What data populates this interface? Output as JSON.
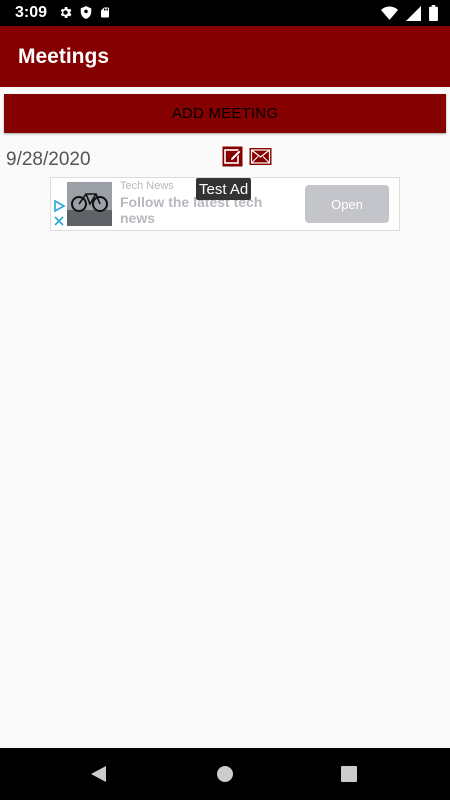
{
  "status_bar": {
    "time": "3:09",
    "left_icons": [
      "gear-icon",
      "shield-icon",
      "sd-card-icon"
    ],
    "right_icons": [
      "wifi-icon",
      "signal-icon",
      "battery-icon"
    ]
  },
  "app_bar": {
    "title": "Meetings"
  },
  "actions": {
    "add_meeting_label": "ADD MEETING"
  },
  "meetings": [
    {
      "date": "9/28/2020",
      "icons": [
        "edit-icon",
        "mail-icon"
      ]
    }
  ],
  "ad": {
    "source": "Tech News",
    "headline": "Follow the latest tech news",
    "cta": "Open",
    "test_label": "Test Ad"
  },
  "colors": {
    "primary": "#850000",
    "status_bar": "#000000",
    "nav_bar": "#000000",
    "background": "#fafafa"
  },
  "nav_bar": {
    "buttons": [
      "back-icon",
      "home-icon",
      "recents-icon"
    ]
  }
}
